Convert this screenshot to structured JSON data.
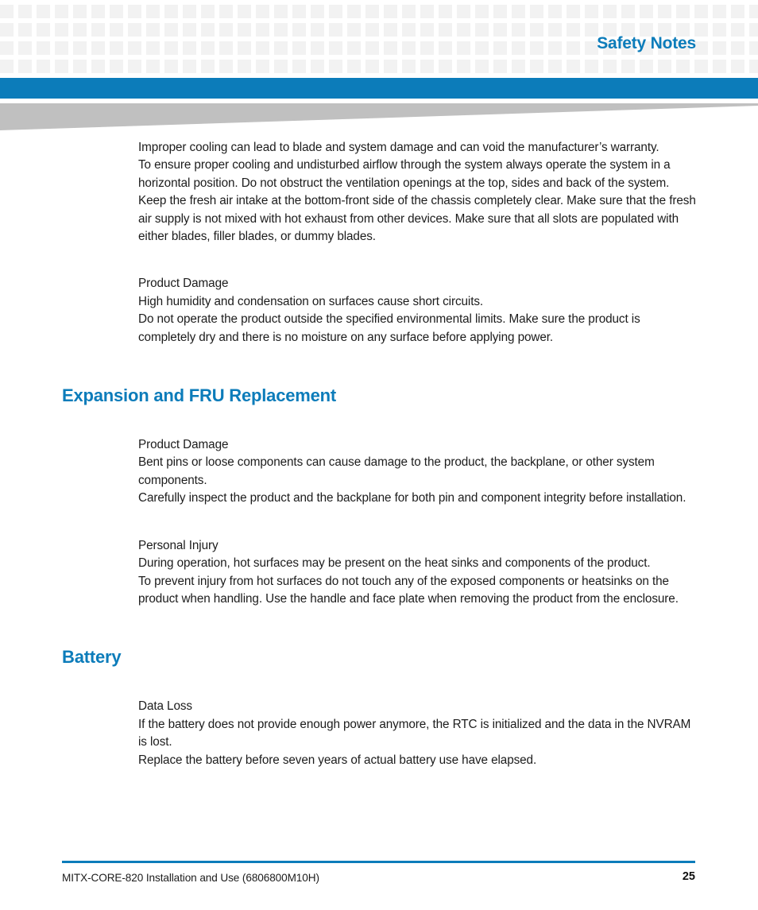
{
  "header": {
    "title": "Safety Notes",
    "accent_color": "#0c7cba",
    "pattern_square_color": "#f2f2f2",
    "wedge_color": "#c0c0c0"
  },
  "content": {
    "blocks": [
      {
        "kind": "paragraph",
        "lines": [
          "Improper cooling can lead to blade and system damage and can void the manufacturer’s warranty.",
          "To ensure proper cooling and undisturbed airflow through the system always operate the system in a horizontal position. Do not obstruct the ventilation openings at the top, sides and back of the system. Keep the fresh air intake at the bottom-front side of the chassis completely clear. Make sure that the fresh air supply is not mixed with hot exhaust from other devices. Make sure that all slots are populated with either blades, filler blades, or dummy blades."
        ]
      },
      {
        "kind": "paragraph",
        "lines": [
          "Product Damage",
          "High humidity and condensation on surfaces cause short circuits.",
          "Do not operate the product outside the specified environmental limits. Make sure the product is completely dry and there is no moisture on any surface before applying power."
        ]
      },
      {
        "kind": "heading",
        "text": "Expansion and FRU Replacement"
      },
      {
        "kind": "paragraph",
        "lines": [
          "Product Damage",
          "Bent pins or loose components can cause damage to the product, the backplane, or other system components.",
          "Carefully inspect the product and the backplane for both pin and component integrity before installation."
        ]
      },
      {
        "kind": "paragraph",
        "lines": [
          "Personal Injury",
          "During operation, hot surfaces may be present on the heat sinks and components of the product.",
          "To prevent injury from hot surfaces do not touch any of the exposed components or heatsinks on the product when handling. Use the handle and face plate when removing the product from the enclosure."
        ]
      },
      {
        "kind": "heading",
        "text": "Battery"
      },
      {
        "kind": "paragraph",
        "lines": [
          "Data Loss",
          "If the battery does not provide enough power anymore, the RTC is initialized and the data in the NVRAM is lost.",
          "Replace the battery before seven years of actual battery use have elapsed."
        ]
      }
    ]
  },
  "footer": {
    "document_title": "MITX-CORE-820 Installation and Use (6806800M10H)",
    "page_number": "25",
    "rule_color": "#0c7cba"
  }
}
